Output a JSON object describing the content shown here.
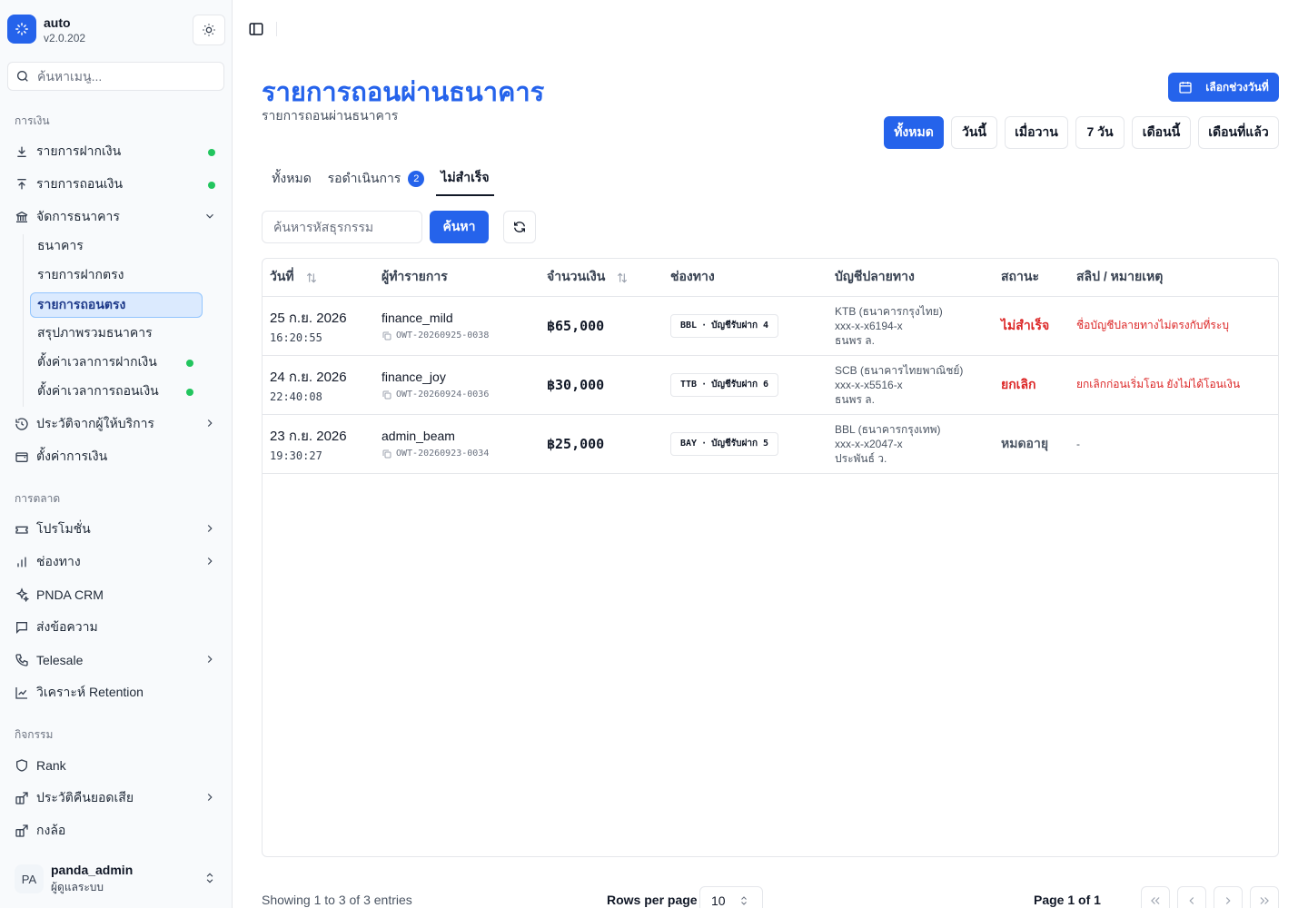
{
  "app": {
    "name": "auto",
    "version": "v2.0.202"
  },
  "menu_search": {
    "placeholder": "ค้นหาเมนู..."
  },
  "nav": {
    "finance_label": "การเงิน",
    "deposits": "รายการฝากเงิน",
    "withdrawals": "รายการถอนเงิน",
    "bank_manage": "จัดการธนาคาร",
    "bank_sub": [
      "ธนาคาร",
      "รายการฝากตรง",
      "รายการถอนตรง",
      "สรุปภาพรวมธนาคาร",
      "ตั้งค่าเวลาการฝากเงิน",
      "ตั้งค่าเวลาการถอนเงิน"
    ],
    "provider_history": "ประวัติจากผู้ให้บริการ",
    "finance_settings": "ตั้งค่าการเงิน",
    "marketing_label": "การตลาด",
    "promotions": "โปรโมชั่น",
    "channels": "ช่องทาง",
    "crm": "PNDA CRM",
    "messages": "ส่งข้อความ",
    "telesale": "Telesale",
    "retention": "วิเคราะห์ Retention",
    "activity_label": "กิจกรรม",
    "rank": "Rank",
    "cashback": "ประวัติคืนยอดเสีย",
    "wheel": "กงล้อ"
  },
  "user": {
    "initials": "PA",
    "name": "panda_admin",
    "role": "ผู้ดูแลระบบ"
  },
  "page": {
    "title": "รายการถอนผ่านธนาคาร",
    "subtitle": "รายการถอนผ่านธนาคาร",
    "range_button": "เลือกช่วงวันที่"
  },
  "date_filters": [
    "ทั้งหมด",
    "วันนี้",
    "เมื่อวาน",
    "7 วัน",
    "เดือนนี้",
    "เดือนที่แล้ว"
  ],
  "tabs": {
    "all": "ทั้งหมด",
    "pending": "รอดำเนินการ",
    "pending_count": "2",
    "failed": "ไม่สำเร็จ"
  },
  "search": {
    "placeholder": "ค้นหารหัสธุรกรรม",
    "button": "ค้นหา"
  },
  "table": {
    "headers": [
      "วันที่",
      "ผู้ทำรายการ",
      "จำนวนเงิน",
      "ช่องทาง",
      "บัญชีปลายทาง",
      "สถานะ",
      "สลิป / หมายเหตุ"
    ],
    "rows": [
      {
        "date": "25 ก.ย. 2026",
        "time": "16:20:55",
        "user": "finance_mild",
        "txid": "OWT-20260925-0038",
        "amount": "฿65,000",
        "bank": "BBL",
        "channel": "บัญชีรับฝาก 4",
        "dest_bank": "KTB (ธนาคารกรุงไทย)",
        "dest_acc": "xxx-x-x6194-x",
        "dest_name": "ธนพร ล.",
        "status": "ไม่สำเร็จ",
        "status_color": "#dc2626",
        "note": "ชื่อบัญชีปลายทางไม่ตรงกับที่ระบุ",
        "note_color": "#dc2626"
      },
      {
        "date": "24 ก.ย. 2026",
        "time": "22:40:08",
        "user": "finance_joy",
        "txid": "OWT-20260924-0036",
        "amount": "฿30,000",
        "bank": "TTB",
        "channel": "บัญชีรับฝาก 6",
        "dest_bank": "SCB (ธนาคารไทยพาณิชย์)",
        "dest_acc": "xxx-x-x5516-x",
        "dest_name": "ธนพร ล.",
        "status": "ยกเลิก",
        "status_color": "#dc2626",
        "note": "ยกเลิกก่อนเริ่มโอน ยังไม่ได้โอนเงิน",
        "note_color": "#dc2626"
      },
      {
        "date": "23 ก.ย. 2026",
        "time": "19:30:27",
        "user": "admin_beam",
        "txid": "OWT-20260923-0034",
        "amount": "฿25,000",
        "bank": "BAY",
        "channel": "บัญชีรับฝาก 5",
        "dest_bank": "BBL (ธนาคารกรุงเทพ)",
        "dest_acc": "xxx-x-x2047-x",
        "dest_name": "ประพันธ์ ว.",
        "status": "หมดอายุ",
        "status_color": "#4b5563",
        "note": "-",
        "note_color": "#4b5563"
      }
    ]
  },
  "footer": {
    "showing": "Showing 1 to 3 of 3 entries",
    "rows_label": "Rows per page",
    "rows_value": "10",
    "page": "Page 1 of 1"
  },
  "colors": {
    "accent": "#2563eb",
    "online_dot": "#22c55e",
    "error": "#dc2626"
  }
}
